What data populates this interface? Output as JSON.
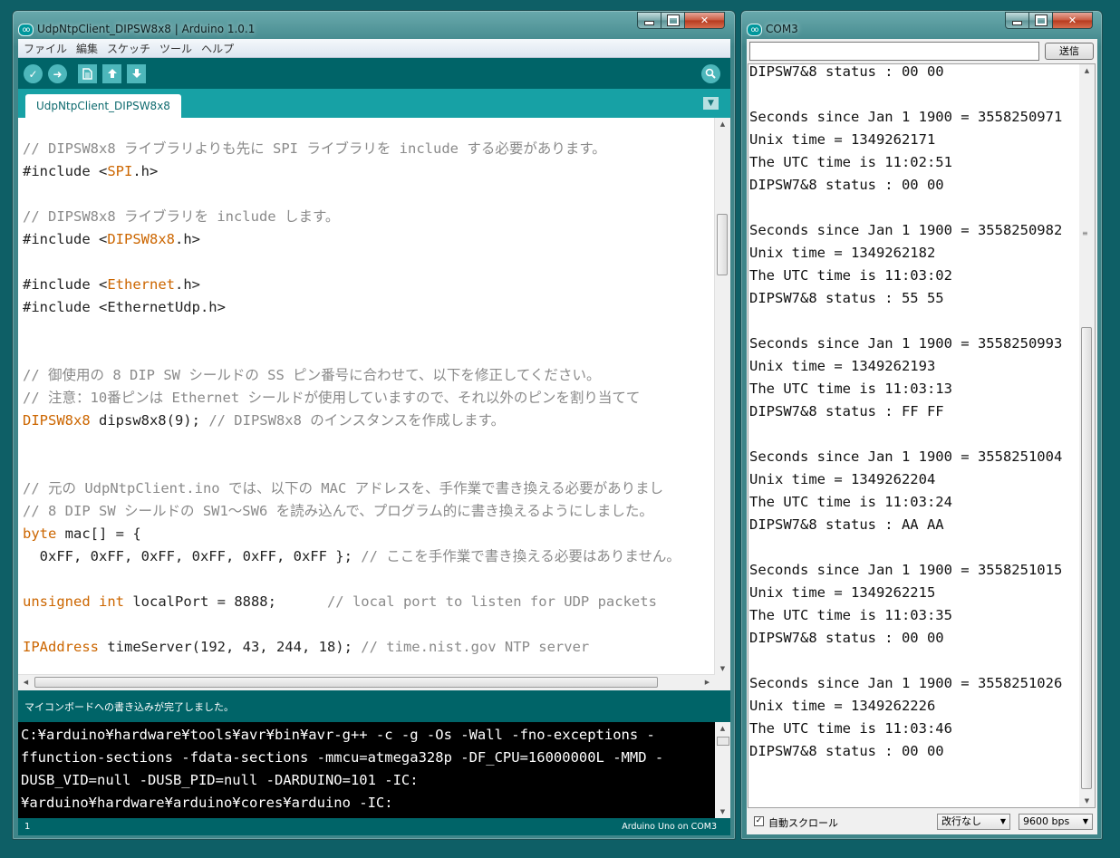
{
  "ide": {
    "title": "UdpNtpClient_DIPSW8x8 | Arduino 1.0.1",
    "menu": [
      "ファイル",
      "編集",
      "スケッチ",
      "ツール",
      "ヘルプ"
    ],
    "toolbar_icons": [
      "verify-icon",
      "upload-icon",
      "new-icon",
      "open-icon",
      "save-icon",
      "serial-monitor-icon"
    ],
    "tab": "UdpNtpClient_DIPSW8x8",
    "code": [
      [
        {
          "t": "// DIPSW8x8 ライブラリよりも先に SPI ライブラリを include する必要があります。",
          "c": "comment"
        }
      ],
      [
        {
          "t": "#include <",
          "c": "plain"
        },
        {
          "t": "SPI",
          "c": "keyword"
        },
        {
          "t": ".h>",
          "c": "plain"
        }
      ],
      [],
      [
        {
          "t": "// DIPSW8x8 ライブラリを include します。",
          "c": "comment"
        }
      ],
      [
        {
          "t": "#include <",
          "c": "plain"
        },
        {
          "t": "DIPSW8x8",
          "c": "keyword"
        },
        {
          "t": ".h>",
          "c": "plain"
        }
      ],
      [],
      [
        {
          "t": "#include <",
          "c": "plain"
        },
        {
          "t": "Ethernet",
          "c": "keyword"
        },
        {
          "t": ".h>",
          "c": "plain"
        }
      ],
      [
        {
          "t": "#include <EthernetUdp.h>",
          "c": "plain"
        }
      ],
      [],
      [],
      [
        {
          "t": "// 御使用の 8 DIP SW シールドの SS ピン番号に合わせて、以下を修正してください。",
          "c": "comment"
        }
      ],
      [
        {
          "t": "// 注意：10番ピンは Ethernet シールドが使用していますので、それ以外のピンを割り当てて",
          "c": "comment"
        }
      ],
      [
        {
          "t": "DIPSW8x8",
          "c": "keyword"
        },
        {
          "t": " dipsw8x8(9); ",
          "c": "plain"
        },
        {
          "t": "// DIPSW8x8 のインスタンスを作成します。",
          "c": "comment"
        }
      ],
      [],
      [],
      [
        {
          "t": "// 元の UdpNtpClient.ino では、以下の MAC アドレスを、手作業で書き換える必要がありまし",
          "c": "comment"
        }
      ],
      [
        {
          "t": "// 8 DIP SW シールドの SW1〜SW6 を読み込んで、プログラム的に書き換えるようにしました。",
          "c": "comment"
        }
      ],
      [
        {
          "t": "byte",
          "c": "keyword"
        },
        {
          "t": " mac[] = {",
          "c": "plain"
        }
      ],
      [
        {
          "t": "  0xFF, 0xFF, 0xFF, 0xFF, 0xFF, 0xFF }; ",
          "c": "plain"
        },
        {
          "t": "// ここを手作業で書き換える必要はありません。",
          "c": "comment"
        }
      ],
      [],
      [
        {
          "t": "unsigned",
          "c": "keyword"
        },
        {
          "t": " ",
          "c": "plain"
        },
        {
          "t": "int",
          "c": "keyword"
        },
        {
          "t": " localPort = 8888;      ",
          "c": "plain"
        },
        {
          "t": "// local port to listen for UDP packets",
          "c": "comment"
        }
      ],
      [],
      [
        {
          "t": "IPAddress",
          "c": "keyword"
        },
        {
          "t": " timeServer(192, 43, 244, 18); ",
          "c": "plain"
        },
        {
          "t": "// time.nist.gov NTP server",
          "c": "comment"
        }
      ]
    ],
    "status_message": "マイコンボードへの書き込みが完了しました。",
    "console_lines": [
      "C:¥arduino¥hardware¥tools¥avr¥bin¥avr-g++ -c -g -Os -Wall -fno-exceptions -",
      "ffunction-sections -fdata-sections -mmcu=atmega328p -DF_CPU=16000000L -MMD -",
      "DUSB_VID=null -DUSB_PID=null -DARDUINO=101 -IC:",
      "¥arduino¥hardware¥arduino¥cores¥arduino -IC:"
    ],
    "line_number": "1",
    "board": "Arduino Uno on COM3"
  },
  "serial": {
    "title": "COM3",
    "input_value": "",
    "send_label": "送信",
    "lines": [
      "DIPSW7&8 status : 00 00",
      "",
      "Seconds since Jan 1 1900 = 3558250971",
      "Unix time = 1349262171",
      "The UTC time is 11:02:51",
      "DIPSW7&8 status : 00 00",
      "",
      "Seconds since Jan 1 1900 = 3558250982",
      "Unix time = 1349262182",
      "The UTC time is 11:03:02",
      "DIPSW7&8 status : 55 55",
      "",
      "Seconds since Jan 1 1900 = 3558250993",
      "Unix time = 1349262193",
      "The UTC time is 11:03:13",
      "DIPSW7&8 status : FF FF",
      "",
      "Seconds since Jan 1 1900 = 3558251004",
      "Unix time = 1349262204",
      "The UTC time is 11:03:24",
      "DIPSW7&8 status : AA AA",
      "",
      "Seconds since Jan 1 1900 = 3558251015",
      "Unix time = 1349262215",
      "The UTC time is 11:03:35",
      "DIPSW7&8 status : 00 00",
      "",
      "Seconds since Jan 1 1900 = 3558251026",
      "Unix time = 1349262226",
      "The UTC time is 11:03:46",
      "DIPSW7&8 status : 00 00"
    ],
    "autoscroll_label": "自動スクロール",
    "autoscroll_checked": true,
    "line_ending": "改行なし",
    "baud": "9600 bps"
  }
}
